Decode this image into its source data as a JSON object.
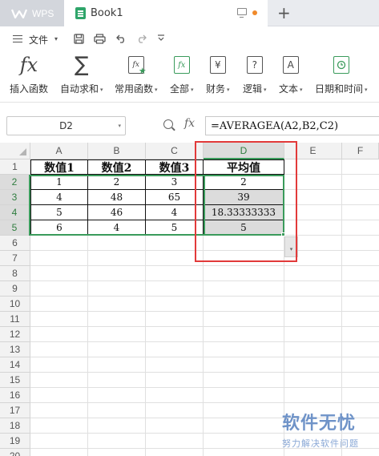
{
  "titlebar": {
    "app_tab": "WPS",
    "doc_tab": "Book1",
    "new_tab": "+"
  },
  "menu": {
    "file_label": "文件",
    "file_caret": "▾",
    "quick_icons": [
      "save-icon",
      "print-icon",
      "undo-icon",
      "redo-icon",
      "more-icon"
    ]
  },
  "ribbon": {
    "items": [
      {
        "label": "插入函数",
        "caret": "",
        "icon": "fx-icon"
      },
      {
        "label": "自动求和",
        "caret": "▾",
        "icon": "sigma-icon"
      },
      {
        "label": "常用函数",
        "caret": "▾",
        "icon": "star-fx-icon"
      },
      {
        "label": "全部",
        "caret": "▾",
        "icon": "fx-box-icon"
      },
      {
        "label": "财务",
        "caret": "▾",
        "icon": "yen-icon"
      },
      {
        "label": "逻辑",
        "caret": "▾",
        "icon": "question-icon"
      },
      {
        "label": "文本",
        "caret": "▾",
        "icon": "text-a-icon"
      },
      {
        "label": "日期和时间",
        "caret": "▾",
        "icon": "clock-icon"
      }
    ],
    "fx_glyph": "fx",
    "sigma_glyph": "∑",
    "yen_glyph": "¥",
    "question_glyph": "?",
    "a_glyph": "A"
  },
  "formula_bar": {
    "name_box": "D2",
    "fx_glyph": "fx",
    "formula": "=AVERAGEA(A2,B2,C2)"
  },
  "grid": {
    "columns": [
      "A",
      "B",
      "C",
      "D",
      "E",
      "F"
    ],
    "rows": [
      "1",
      "2",
      "3",
      "4",
      "5",
      "6",
      "7",
      "8",
      "9",
      "10",
      "11",
      "12",
      "13",
      "14",
      "15",
      "16",
      "17",
      "18",
      "19",
      "20"
    ],
    "selected_column": "D",
    "selected_rows": [
      "2",
      "3",
      "4",
      "5"
    ],
    "table": [
      [
        "数值1",
        "数值2",
        "数值3",
        "平均值"
      ],
      [
        "1",
        "2",
        "3",
        "2"
      ],
      [
        "4",
        "48",
        "65",
        "39"
      ],
      [
        "5",
        "46",
        "4",
        "18.33333333"
      ],
      [
        "6",
        "4",
        "5",
        "5"
      ]
    ],
    "fill_options_caret": "▾"
  },
  "watermark": {
    "title": "软件无忧",
    "subtitle": "努力解决软件问题"
  },
  "colors": {
    "selection_green": "#3a9b5b",
    "highlight_red": "#e23a3a",
    "sheet_icon_green": "#2fa56a"
  }
}
